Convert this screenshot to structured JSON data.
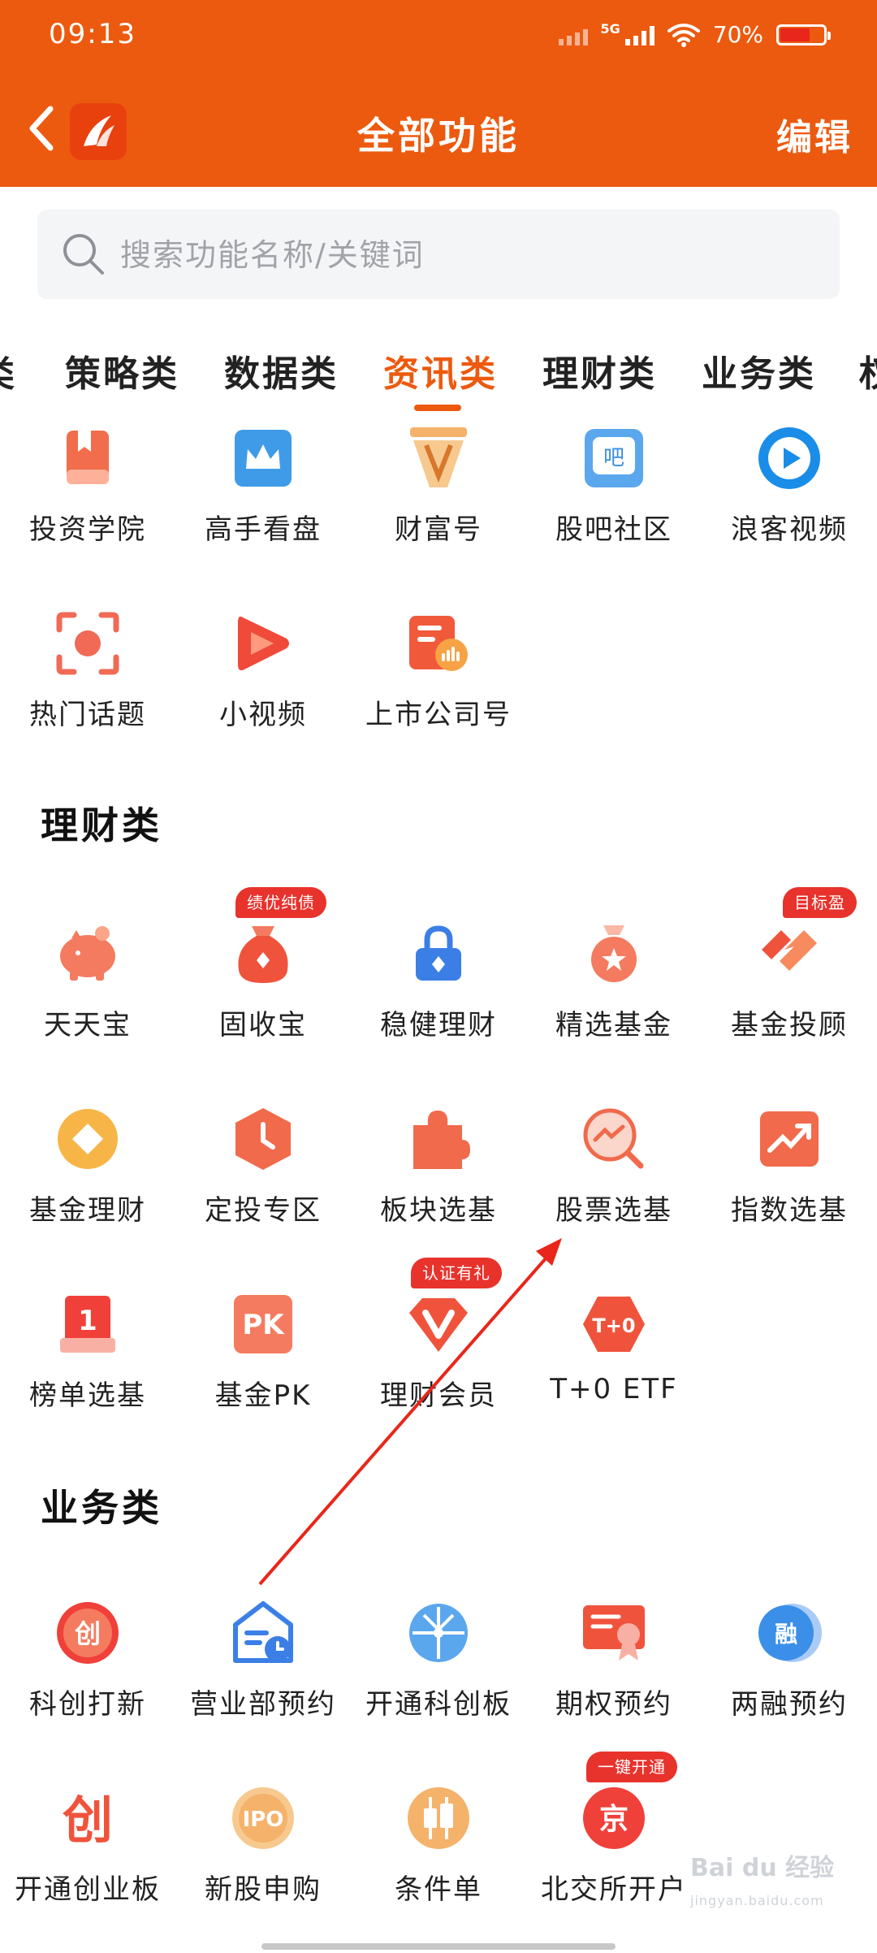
{
  "status_bar": {
    "time": "09:13",
    "network": "5G",
    "battery": "70%",
    "battery_level": 0.7
  },
  "header": {
    "title": "全部功能",
    "edit_label": "编辑",
    "back_icon": "chevron-left-icon",
    "logo_icon": "eastmoney-logo-icon"
  },
  "search": {
    "placeholder": "搜索功能名称/关键词",
    "value": ""
  },
  "tabs": {
    "items": [
      {
        "label": "类"
      },
      {
        "label": "策略类"
      },
      {
        "label": "数据类"
      },
      {
        "label": "资讯类"
      },
      {
        "label": "理财类"
      },
      {
        "label": "业务类"
      },
      {
        "label": "权"
      }
    ],
    "active": "资讯类",
    "accent_color": "#ec5a0f"
  },
  "news_section": {
    "items": [
      {
        "label": "投资学院",
        "icon": "book-icon"
      },
      {
        "label": "高手看盘",
        "icon": "crown-icon"
      },
      {
        "label": "财富号",
        "icon": "pen-nib-icon"
      },
      {
        "label": "股吧社区",
        "icon": "ba-chat-icon"
      },
      {
        "label": "浪客视频",
        "icon": "play-circle-icon"
      },
      {
        "label": "热门话题",
        "icon": "focus-target-icon"
      },
      {
        "label": "小视频",
        "icon": "play-triangle-icon"
      },
      {
        "label": "上市公司号",
        "icon": "company-chart-icon"
      }
    ]
  },
  "wealth_section": {
    "title": "理财类",
    "items": [
      {
        "label": "天天宝",
        "icon": "piggy-bank-icon"
      },
      {
        "label": "固收宝",
        "icon": "money-bag-icon",
        "badge": "绩优纯债"
      },
      {
        "label": "稳健理财",
        "icon": "lock-icon"
      },
      {
        "label": "精选基金",
        "icon": "medal-star-icon"
      },
      {
        "label": "基金投顾",
        "icon": "advisor-icon",
        "badge": "目标盈"
      },
      {
        "label": "基金理财",
        "icon": "diamond-coin-icon"
      },
      {
        "label": "定投专区",
        "icon": "clock-hexagon-icon"
      },
      {
        "label": "板块选基",
        "icon": "puzzle-icon"
      },
      {
        "label": "股票选基",
        "icon": "trend-search-icon"
      },
      {
        "label": "指数选基",
        "icon": "trend-chart-icon"
      },
      {
        "label": "榜单选基",
        "icon": "rank-one-icon"
      },
      {
        "label": "基金PK",
        "icon": "pk-icon"
      },
      {
        "label": "理财会员",
        "icon": "vip-diamond-icon",
        "badge": "认证有礼"
      },
      {
        "label": "T+0 ETF",
        "icon": "t0-hexagon-icon"
      }
    ]
  },
  "business_section": {
    "title": "业务类",
    "items": [
      {
        "label": "科创打新",
        "icon": "chuang-circle-icon"
      },
      {
        "label": "营业部预约",
        "icon": "branch-clock-icon"
      },
      {
        "label": "开通科创板",
        "icon": "circuit-globe-icon"
      },
      {
        "label": "期权预约",
        "icon": "certificate-icon"
      },
      {
        "label": "两融预约",
        "icon": "rong-circle-icon"
      },
      {
        "label": "开通创业板",
        "icon": "chuang-text-icon"
      },
      {
        "label": "新股申购",
        "icon": "ipo-circle-icon"
      },
      {
        "label": "条件单",
        "icon": "candlestick-icon"
      },
      {
        "label": "北交所开户",
        "icon": "jing-circle-icon",
        "badge": "一键开通"
      }
    ]
  },
  "watermark": {
    "text": "Bai du 经验",
    "sub": "jingyan.baidu.com"
  }
}
